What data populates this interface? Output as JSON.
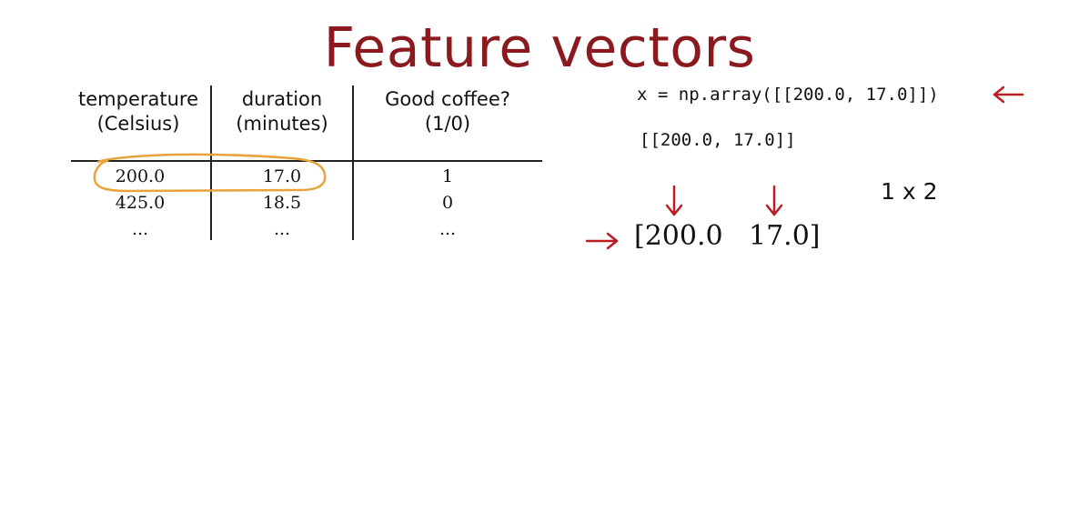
{
  "slide": {
    "title": "Feature vectors"
  },
  "table": {
    "headers": [
      {
        "line1": "temperature",
        "line2": "(Celsius)"
      },
      {
        "line1": "duration",
        "line2": "(minutes)"
      },
      {
        "line1": "Good coffee?",
        "line2": "(1/0)"
      }
    ],
    "rows": [
      [
        "200.0",
        "17.0",
        "1"
      ],
      [
        "425.0",
        "18.5",
        "0"
      ],
      [
        "...",
        "...",
        "..."
      ]
    ]
  },
  "code": {
    "line1": "x = np.array([[200.0, 17.0]])",
    "line2": "[[200.0, 17.0]]"
  },
  "vector": {
    "first": "[200.0",
    "second": "17.0]"
  },
  "shape_label": "1 x 2",
  "colors": {
    "title": "#8b1a1f",
    "annotation_red": "#b81d24",
    "highlight_orange": "#e8a33a"
  }
}
